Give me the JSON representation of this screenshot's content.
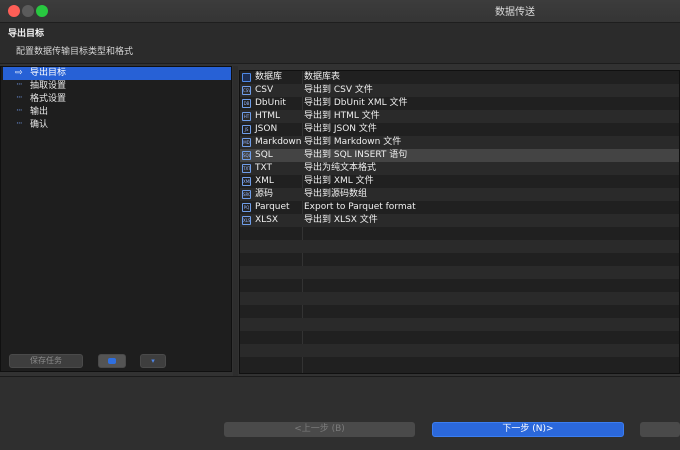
{
  "window": {
    "title": "数据传送",
    "traffic_lights": [
      "close",
      "minimize",
      "zoom"
    ]
  },
  "header": {
    "title": "导出目标",
    "subtitle": "配置数据传输目标类型和格式"
  },
  "tree": {
    "items": [
      {
        "label": "导出目标",
        "selected": true,
        "icon": "arrow-right-icon"
      },
      {
        "label": "抽取设置",
        "selected": false,
        "icon": "dotted-connector-icon"
      },
      {
        "label": "格式设置",
        "selected": false,
        "icon": "dotted-connector-icon"
      },
      {
        "label": "输出",
        "selected": false,
        "icon": "dotted-connector-icon"
      },
      {
        "label": "确认",
        "selected": false,
        "icon": "dotted-connector-icon"
      }
    ]
  },
  "left_buttons": {
    "save_task": "保存任务",
    "settings_icon": "gear-icon",
    "load_icon": "load-icon"
  },
  "table": {
    "rows": [
      {
        "name": "数据库",
        "desc": "数据库表",
        "icon": "database-table-icon"
      },
      {
        "name": "CSV",
        "desc": "导出到 CSV 文件",
        "icon": "csv-file-icon"
      },
      {
        "name": "DbUnit",
        "desc": "导出到 DbUnit XML 文件",
        "icon": "dbunit-file-icon"
      },
      {
        "name": "HTML",
        "desc": "导出到 HTML 文件",
        "icon": "html-file-icon"
      },
      {
        "name": "JSON",
        "desc": "导出到 JSON 文件",
        "icon": "json-file-icon"
      },
      {
        "name": "Markdown",
        "desc": "导出到 Markdown 文件",
        "icon": "markdown-file-icon"
      },
      {
        "name": "SQL",
        "desc": "导出到 SQL INSERT 语句",
        "icon": "sql-file-icon",
        "highlighted": true
      },
      {
        "name": "TXT",
        "desc": "导出为纯文本格式",
        "icon": "txt-file-icon"
      },
      {
        "name": "XML",
        "desc": "导出到 XML 文件",
        "icon": "xml-file-icon"
      },
      {
        "name": "源码",
        "desc": "导出到源码数组",
        "icon": "source-code-file-icon"
      },
      {
        "name": "Parquet",
        "desc": "Export to Parquet format",
        "icon": "parquet-file-icon"
      },
      {
        "name": "XLSX",
        "desc": "导出到 XLSX 文件",
        "icon": "xlsx-file-icon"
      }
    ]
  },
  "footer": {
    "prev": "<上一步 (B)",
    "next": "下一步 (N)>"
  },
  "colors": {
    "selection": "#2761d6",
    "primary_button": "#2b68db",
    "row_highlight": "#444444"
  }
}
